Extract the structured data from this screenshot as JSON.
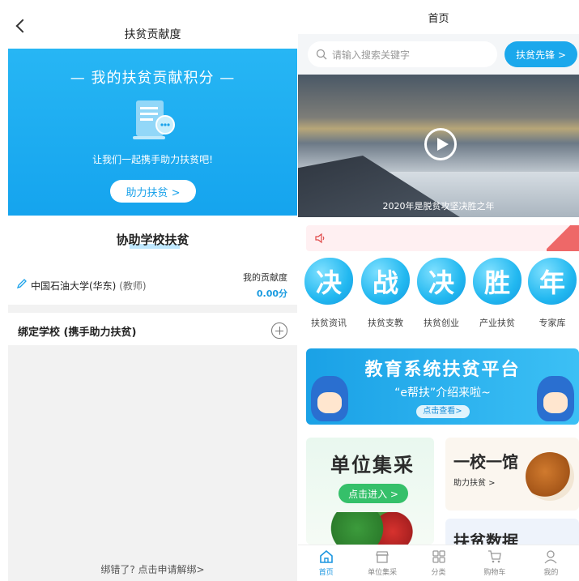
{
  "left": {
    "nav_title": "扶贫贡献度",
    "hero": {
      "title": "— 我的扶贫贡献积分 —",
      "subtitle": "让我们一起携手助力扶贫吧!",
      "button": "助力扶贫 >"
    },
    "section_title": "协助学校扶贫",
    "school": {
      "name": "中国石油大学(华东)",
      "role": "(教师)",
      "contrib_label": "我的贡献度",
      "contrib_value": "0.00分"
    },
    "bind_label": "绑定学校 (携手助力扶贫)",
    "unbind_link": "绑错了? 点击申请解绑>"
  },
  "right": {
    "nav_title": "首页",
    "search_placeholder": "请输入搜索关键字",
    "pioneer_button": "扶贫先锋 >",
    "video_caption": "2020年是脱贫攻坚决胜之年",
    "categories": [
      {
        "glyph": "决",
        "label": "扶贫资讯"
      },
      {
        "glyph": "战",
        "label": "扶贫支教"
      },
      {
        "glyph": "决",
        "label": "扶贫创业"
      },
      {
        "glyph": "胜",
        "label": "产业扶贫"
      },
      {
        "glyph": "年",
        "label": "专家库"
      }
    ],
    "banner": {
      "title": "教育系统扶贫平台",
      "subtitle": "“e帮扶”介绍来啦~",
      "button": "点击查看>"
    },
    "unit_tile": {
      "title": "单位集采",
      "button": "点击进入 >"
    },
    "school_tile": {
      "title": "一校一馆",
      "sub": "助力扶贫 >"
    },
    "data_tile": {
      "title": "扶贫数据"
    },
    "tabs": [
      {
        "label": "首页",
        "icon": "home-icon",
        "active": true
      },
      {
        "label": "单位集采",
        "icon": "store-icon",
        "active": false
      },
      {
        "label": "分类",
        "icon": "grid-icon",
        "active": false
      },
      {
        "label": "购物车",
        "icon": "cart-icon",
        "active": false
      },
      {
        "label": "我的",
        "icon": "user-icon",
        "active": false
      }
    ],
    "colors": {
      "accent": "#1ba8ec",
      "active_tab": "#1b96e0",
      "contrib": "#1a9be0",
      "green": "#35c06a"
    }
  }
}
